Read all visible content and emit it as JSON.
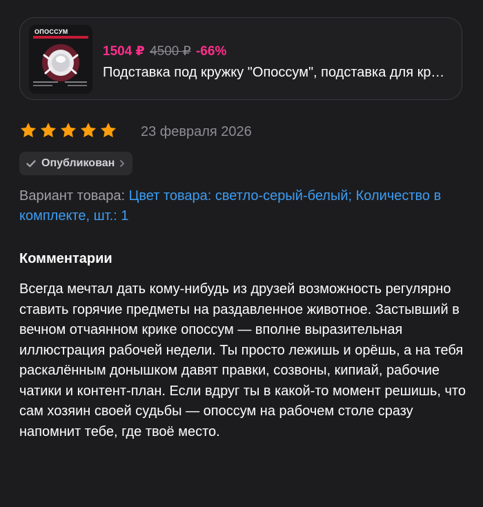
{
  "product": {
    "image_brand_text": "ОПОССУМ",
    "price_current": "1504 ₽",
    "price_old": "4500 ₽",
    "discount": "-66%",
    "title": "Подставка под кружку \"Опоссум\", подставка для кружки, стакана"
  },
  "review": {
    "rating": 5,
    "rating_max": 5,
    "date": "23 февраля 2026",
    "status": "Опубликован",
    "variant_label": "Вариант товара:",
    "variant_value": "Цвет товара: светло-серый-белый; Количество в комплекте, шт.: 1",
    "comment_heading": "Комментарии",
    "comment_text": "Всегда мечтал дать кому-нибудь из друзей возможность регулярно ставить горячие предметы на раздавленное животное. Застывший в вечном отчаянном крике опоссум — вполне выразительная иллюстрация рабочей недели. Ты просто лежишь и орёшь, а на тебя раскалённым донышком давят правки, созвоны, кипиай, рабочие чатики и контент-план. Если вдруг ты в какой-то момент решишь, что сам хозяин своей судьбы — опоссум на рабочем столе сразу напомнит тебе, где твоё место."
  },
  "colors": {
    "background": "#1c1c1e",
    "price_accent": "#ff2e8a",
    "star": "#ff9e0b",
    "link": "#3d9df3",
    "muted_text": "#8e8e93"
  },
  "icons": [
    "star-icon",
    "checkmark-icon",
    "chevron-right-icon"
  ]
}
